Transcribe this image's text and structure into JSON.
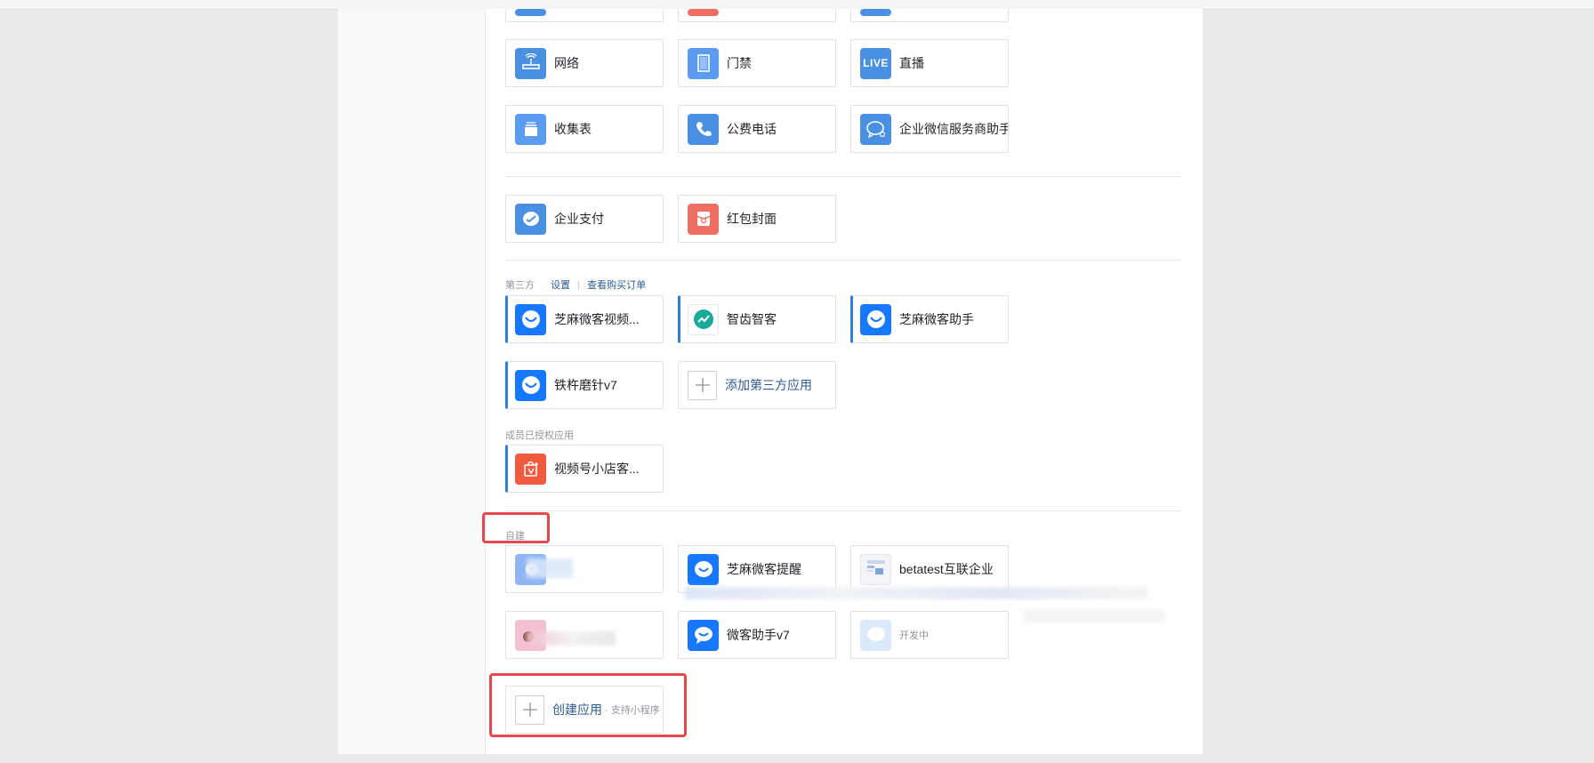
{
  "grid_top": {
    "row1": [
      {
        "name": "网络",
        "color": "#4a90e2"
      },
      {
        "name": "门禁",
        "color": "#5b9cf0"
      },
      {
        "name": "直播",
        "color": "#4a90e2",
        "icon_text": "LIVE"
      }
    ],
    "row2": [
      {
        "name": "收集表",
        "color": "#5b9cf0"
      },
      {
        "name": "公费电话",
        "color": "#4a90e2"
      },
      {
        "name": "企业微信服务商助手",
        "color": "#4a90e2"
      }
    ]
  },
  "payments": [
    {
      "name": "企业支付",
      "color": "#4a90e2"
    },
    {
      "name": "红包封面",
      "color": "#ef6f63"
    }
  ],
  "third_party": {
    "title": "第三方",
    "settings_link": "设置",
    "orders_link": "查看购买订单",
    "apps": [
      {
        "name": "芝麻微客视频..."
      },
      {
        "name": "智齿智客"
      },
      {
        "name": "芝麻微客助手"
      },
      {
        "name": "铁杵磨针v7"
      }
    ],
    "add_label": "添加第三方应用"
  },
  "member_authorized": {
    "title": "成员已授权应用",
    "apps": [
      {
        "name": "视频号小店客..."
      }
    ]
  },
  "self_built": {
    "title": "自建",
    "apps": [
      {
        "name": ""
      },
      {
        "name": "芝麻微客提醒"
      },
      {
        "name": "betatest互联企业"
      },
      {
        "name": ""
      },
      {
        "name": "微客助手v7"
      },
      {
        "name": "",
        "status": "开发中"
      }
    ],
    "create_label": "创建应用",
    "create_sub": "· 支持小程序"
  },
  "colors": {
    "accent": "#2f7de1",
    "link": "#2e5c93",
    "highlight": "#e5484d"
  }
}
